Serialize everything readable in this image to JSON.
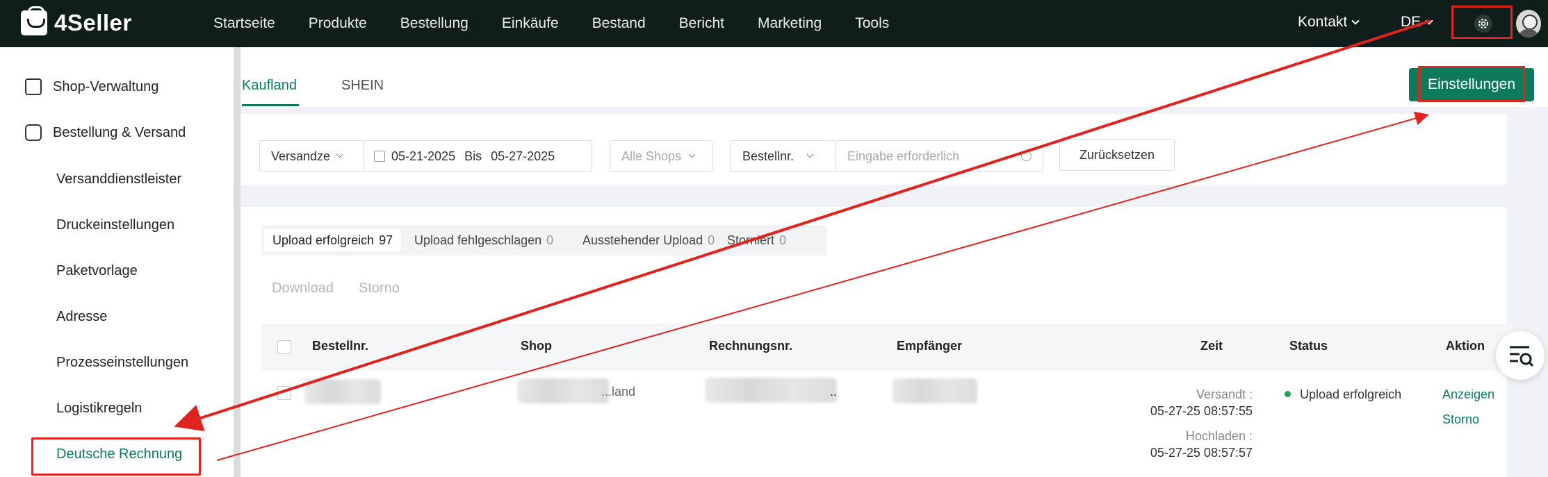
{
  "app": {
    "logo": "4Seller"
  },
  "nav": [
    "Startseite",
    "Produkte",
    "Bestellung",
    "Einkäufe",
    "Bestand",
    "Bericht",
    "Marketing",
    "Tools"
  ],
  "header": {
    "contact": "Kontakt",
    "language": "DE",
    "settings_icon": "gear-icon",
    "avatar_icon": "avatar"
  },
  "sidebar": {
    "groups": [
      {
        "label": "Shop-Verwaltung",
        "icon": "store-icon"
      },
      {
        "label": "Bestellung & Versand",
        "icon": "order-icon"
      }
    ],
    "items": [
      "Versanddienstleister",
      "Druckeinstellungen",
      "Paketvorlage",
      "Adresse",
      "Prozesseinstellungen",
      "Logistikregeln",
      "Deutsche Rechnung"
    ],
    "active_item": "Deutsche Rechnung"
  },
  "tabs": {
    "items": [
      "Kaufland",
      "SHEIN"
    ],
    "active": "Kaufland"
  },
  "settings_button": "Einstellungen",
  "filters": {
    "date_type": "Versandze",
    "date_from": "05-21-2025",
    "date_to_label": "Bis",
    "date_to": "05-27-2025",
    "shops": "Alle Shops",
    "search_field": "Bestellnr.",
    "search_placeholder": "Eingabe erforderlich",
    "reset": "Zurücksetzen"
  },
  "status_tabs": [
    {
      "label": "Upload erfolgreich",
      "count": "97"
    },
    {
      "label": "Upload fehlgeschlagen",
      "count": "0"
    },
    {
      "label": "Ausstehender Upload",
      "count": "0"
    },
    {
      "label": "Storniert",
      "count": "0"
    }
  ],
  "bulk_actions": [
    "Download",
    "Storno"
  ],
  "table": {
    "columns": [
      "Bestellnr.",
      "Shop",
      "Rechnungsnr.",
      "Empfänger",
      "Zeit",
      "Status",
      "Aktion"
    ],
    "rows": [
      {
        "shop_suffix": "...land",
        "invoice_suffix": "..",
        "shipped_label": "Versandt :",
        "shipped_time": "05-27-25 08:57:55",
        "uploaded_label": "Hochladen :",
        "uploaded_time": "05-27-25 08:57:57",
        "status": "Upload erfolgreich",
        "actions": [
          "Anzeigen",
          "Storno"
        ]
      }
    ]
  },
  "colors": {
    "brand": "#0d7a5a",
    "topbar": "#0f1e1a",
    "highlight": "#e0231e"
  }
}
